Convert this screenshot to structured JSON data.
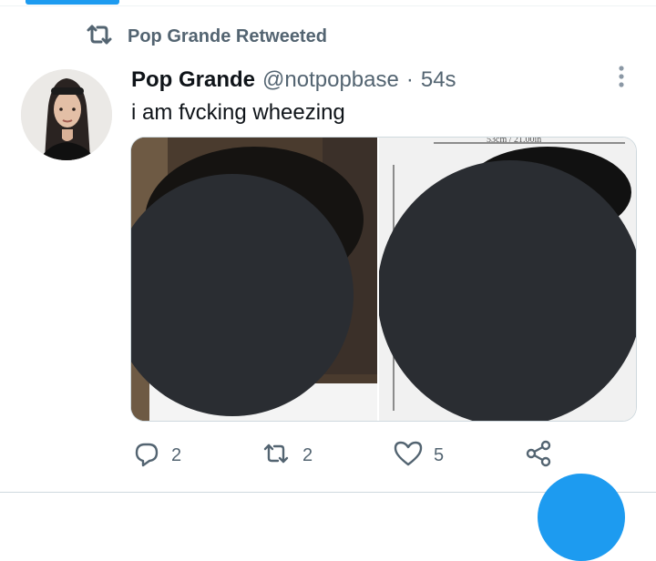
{
  "retweet": {
    "label": "Pop Grande Retweeted",
    "icon": "retweet-icon"
  },
  "tweet": {
    "display_name": "Pop Grande",
    "handle": "@notpopbase",
    "separator": "·",
    "time": "54s",
    "text": "i am fvcking wheezing"
  },
  "media": {
    "count": 2,
    "right_image_caption": "53cm / 21.00in"
  },
  "actions": {
    "reply_count": "2",
    "retweet_count": "2",
    "like_count": "5"
  },
  "colors": {
    "accent": "#1d9bf0",
    "secondary_text": "#536471",
    "primary_text": "#0f1419",
    "censor": "#2a2d32"
  }
}
